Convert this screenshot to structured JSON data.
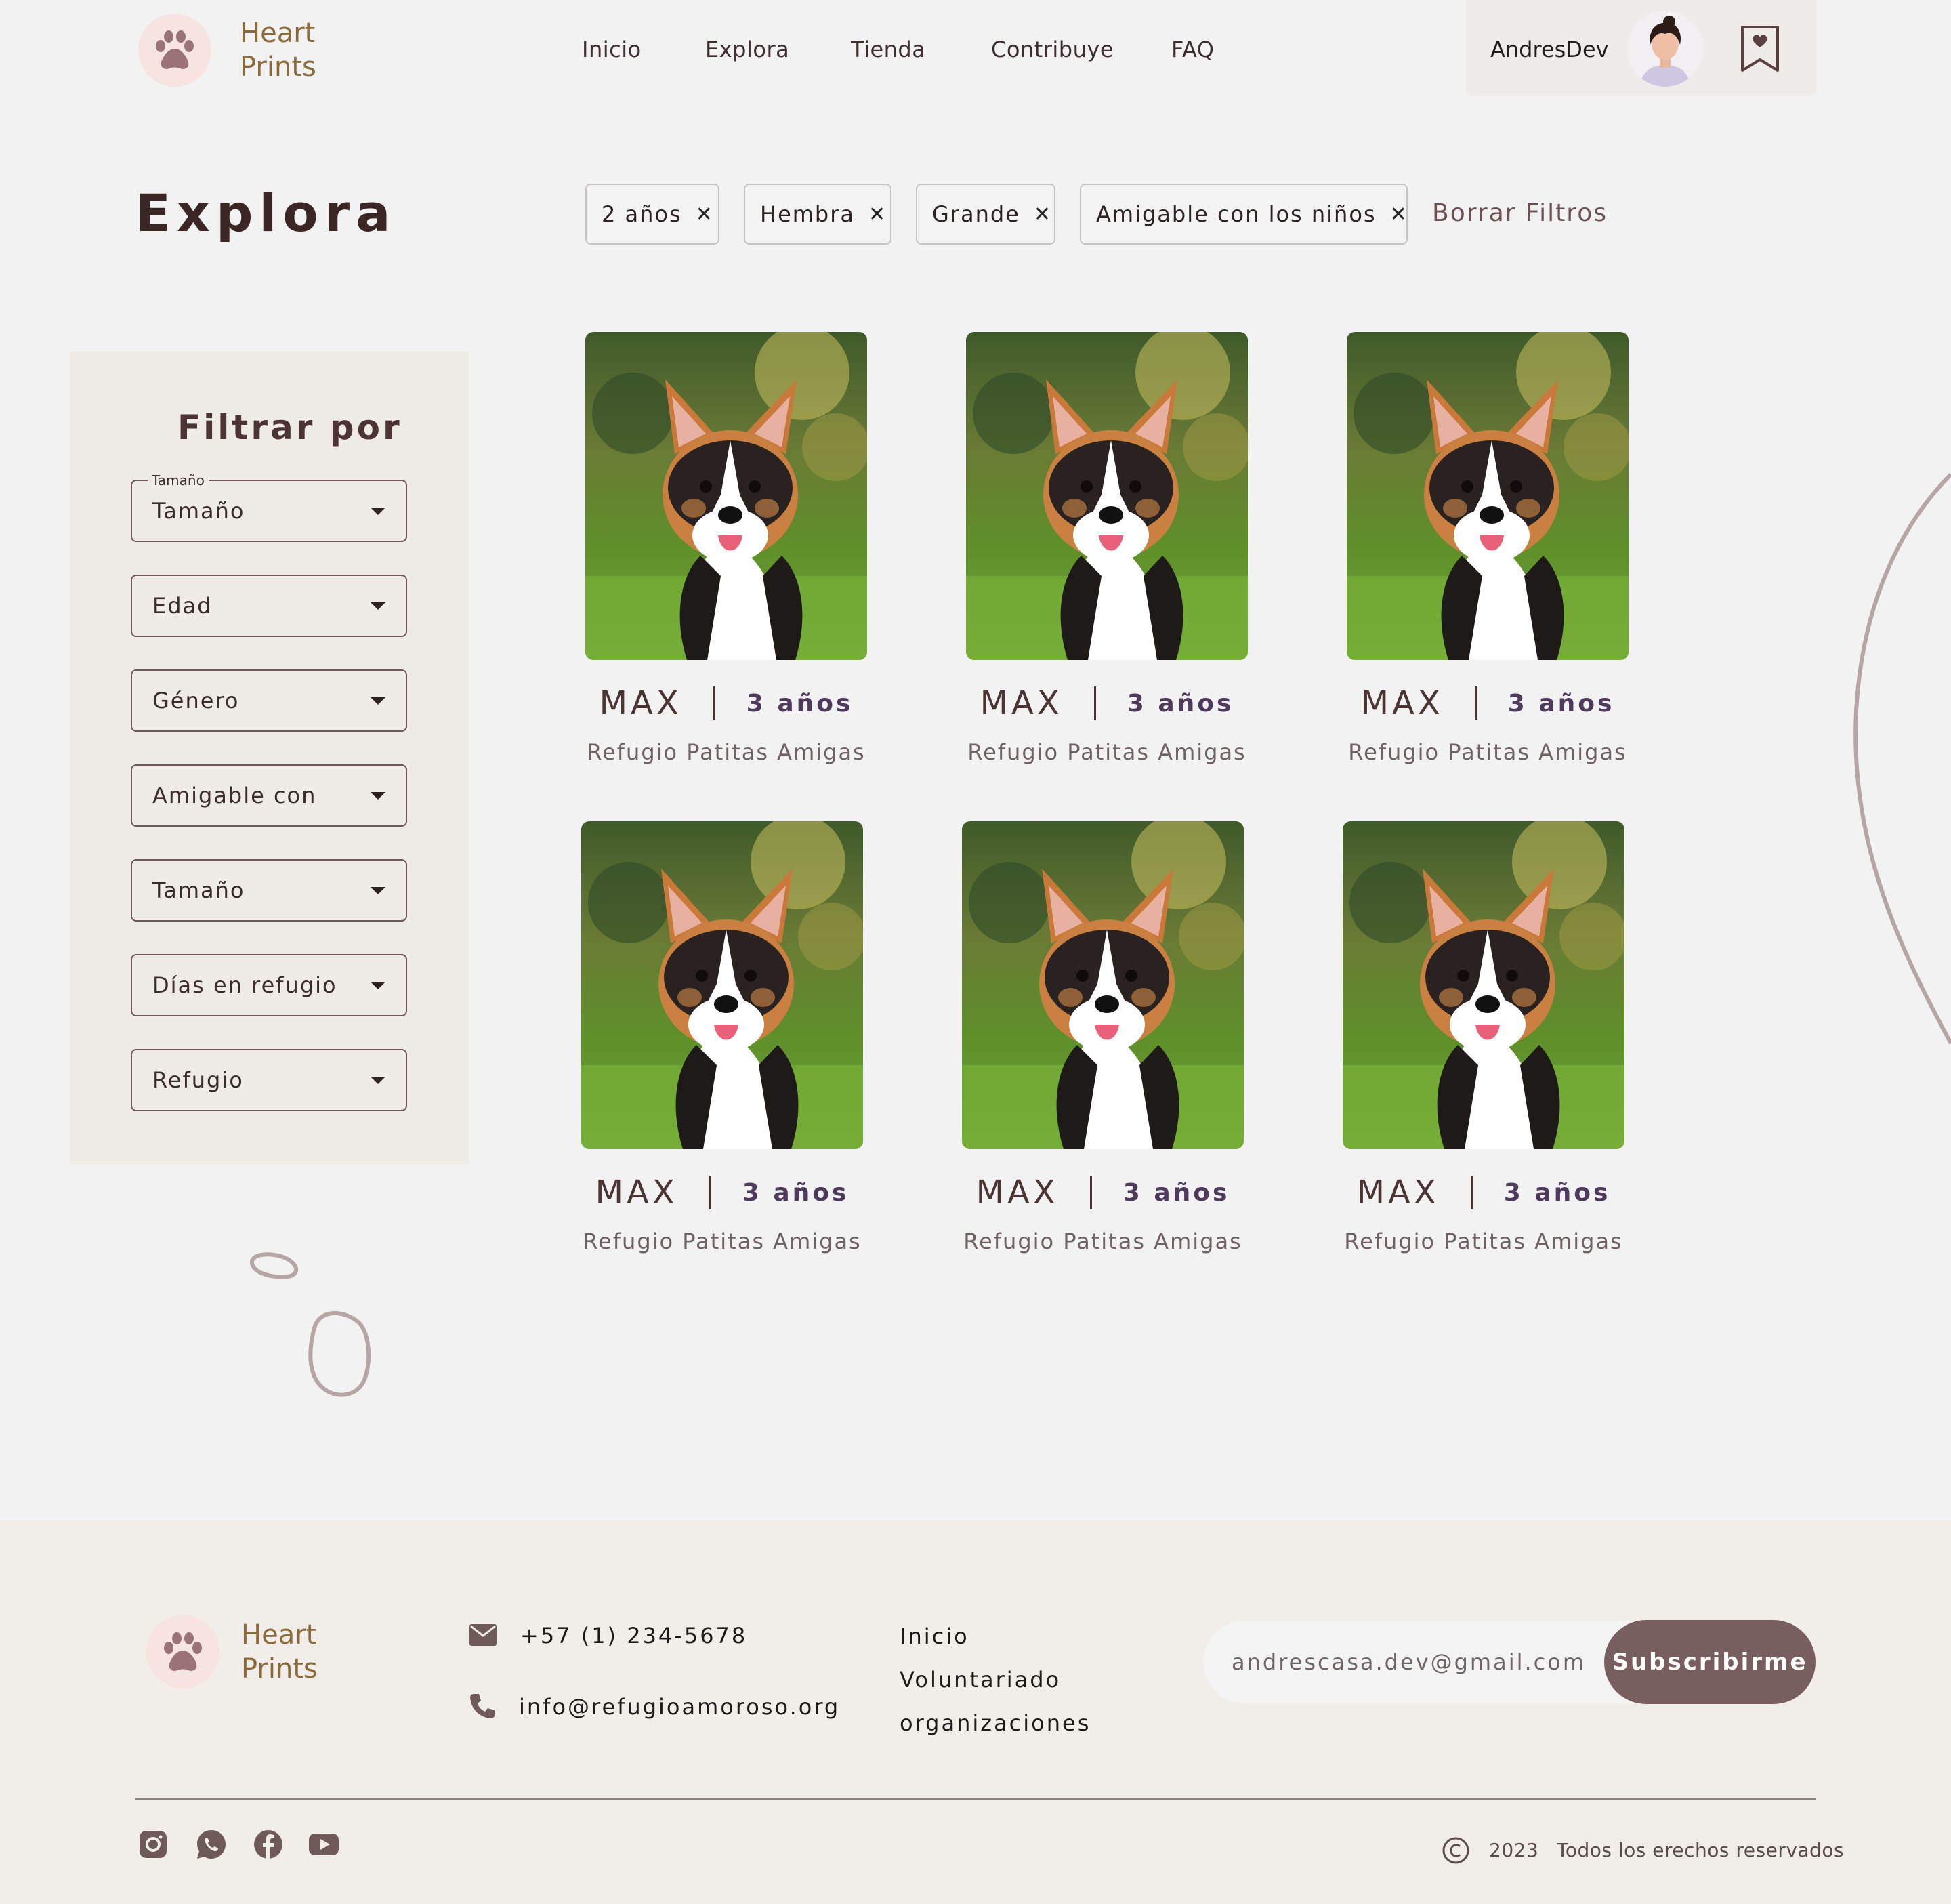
{
  "brand": {
    "line1": "Heart",
    "line2": "Prints"
  },
  "nav": {
    "items": [
      "Inicio",
      "Explora",
      "Tienda",
      "Contribuye",
      "FAQ"
    ]
  },
  "user": {
    "name": "AndresDev"
  },
  "page": {
    "title": "Explora"
  },
  "filters": {
    "chips": [
      "2 años",
      "Hembra",
      "Grande",
      "Amigable con los niños"
    ],
    "remove_glyph": "✕",
    "clear_label": "Borrar Filtros"
  },
  "sidebar": {
    "title": "Filtrar por",
    "floating_label": "Tamaño",
    "selects": [
      "Tamaño",
      "Edad",
      "Género",
      "Amigable con",
      "Tamaño",
      "Días en refugio",
      "Refugio"
    ]
  },
  "pets": [
    {
      "name": "MAX",
      "age": "3 años",
      "shelter": "Refugio Patitas Amigas"
    },
    {
      "name": "MAX",
      "age": "3 años",
      "shelter": "Refugio Patitas Amigas"
    },
    {
      "name": "MAX",
      "age": "3 años",
      "shelter": "Refugio Patitas Amigas"
    },
    {
      "name": "MAX",
      "age": "3 años",
      "shelter": "Refugio Patitas Amigas"
    },
    {
      "name": "MAX",
      "age": "3 años",
      "shelter": "Refugio Patitas Amigas"
    },
    {
      "name": "MAX",
      "age": "3 años",
      "shelter": "Refugio Patitas Amigas"
    }
  ],
  "footer": {
    "phone": "+57 (1) 234-5678",
    "email": "info@refugioamoroso.org",
    "links": [
      "Inicio",
      "Voluntariado",
      "organizaciones"
    ],
    "newsletter": {
      "value": "andrescasa.dev@gmail.com",
      "button": "Subscribirme"
    },
    "social": [
      "instagram-icon",
      "whatsapp-icon",
      "facebook-icon",
      "youtube-icon"
    ],
    "year": "2023",
    "rights": "Todos los erechos reservados"
  },
  "colors": {
    "background": "#f2f2f2",
    "panel": "#efebe7",
    "brand_text": "#8a6a3a",
    "paw": "#9a7474",
    "primary_button": "#785e5e"
  }
}
